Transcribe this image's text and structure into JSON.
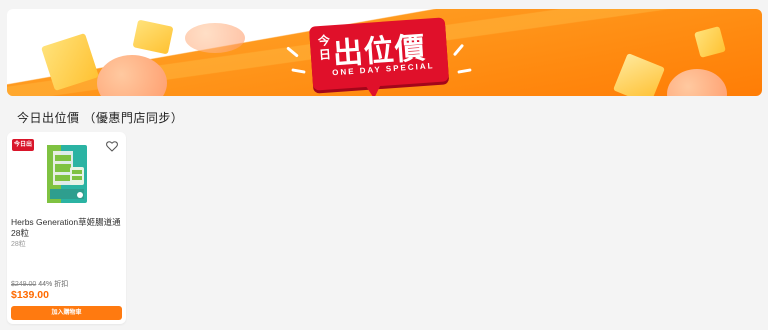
{
  "banner": {
    "today_label": "今日",
    "main_text": "出位價",
    "sub_text": "ONE DAY SPECIAL"
  },
  "section": {
    "title": "今日出位價 （優惠門店同步）"
  },
  "products": [
    {
      "promo_tag": "今日出位價",
      "name": "Herbs Generation草姬腸道通28粒",
      "desc": "28粒",
      "original_price": "$249.00",
      "discount": "44% 折扣",
      "price": "$139.00",
      "cart_label": "加入購物車"
    }
  ],
  "colors": {
    "accent": "#ff7a10",
    "price": "#ff6a00",
    "badge_red": "#e0102a"
  },
  "icons": {
    "wishlist": "heart-outline-icon"
  }
}
